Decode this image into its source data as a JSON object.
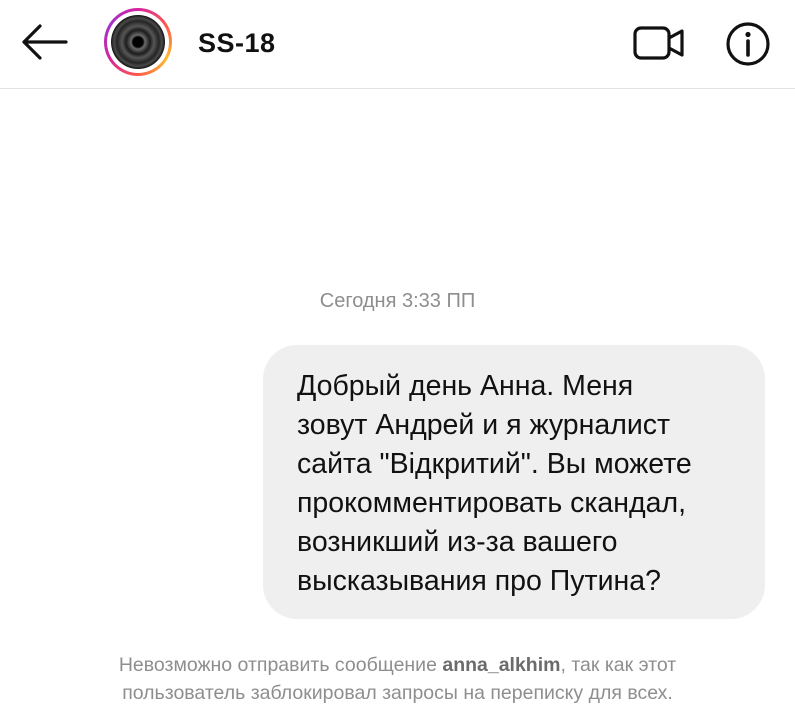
{
  "header": {
    "username": "SS-18",
    "back_icon": "arrow-left-icon",
    "video_icon": "video-camera-icon",
    "info_icon": "info-icon"
  },
  "thread": {
    "timestamp": "Сегодня 3:33 ПП",
    "message": {
      "lines": [
        "Добрый день Анна. Меня",
        "зовут Андрей и я журналист",
        "сайта \"Відкритий\". Вы можете",
        "прокомментировать скандал,",
        "возникший из-за вашего",
        "высказывания про Путина?"
      ]
    }
  },
  "notice": {
    "before": "Невозможно отправить сообщение ",
    "username": "anna_alkhim",
    "after_line1": ", так как этот",
    "line2": "пользователь заблокировал запросы на переписку для всех."
  },
  "colors": {
    "bubble_bg": "#efefef",
    "secondary_text": "#8e8e8e",
    "divider": "#e2e2e2"
  }
}
